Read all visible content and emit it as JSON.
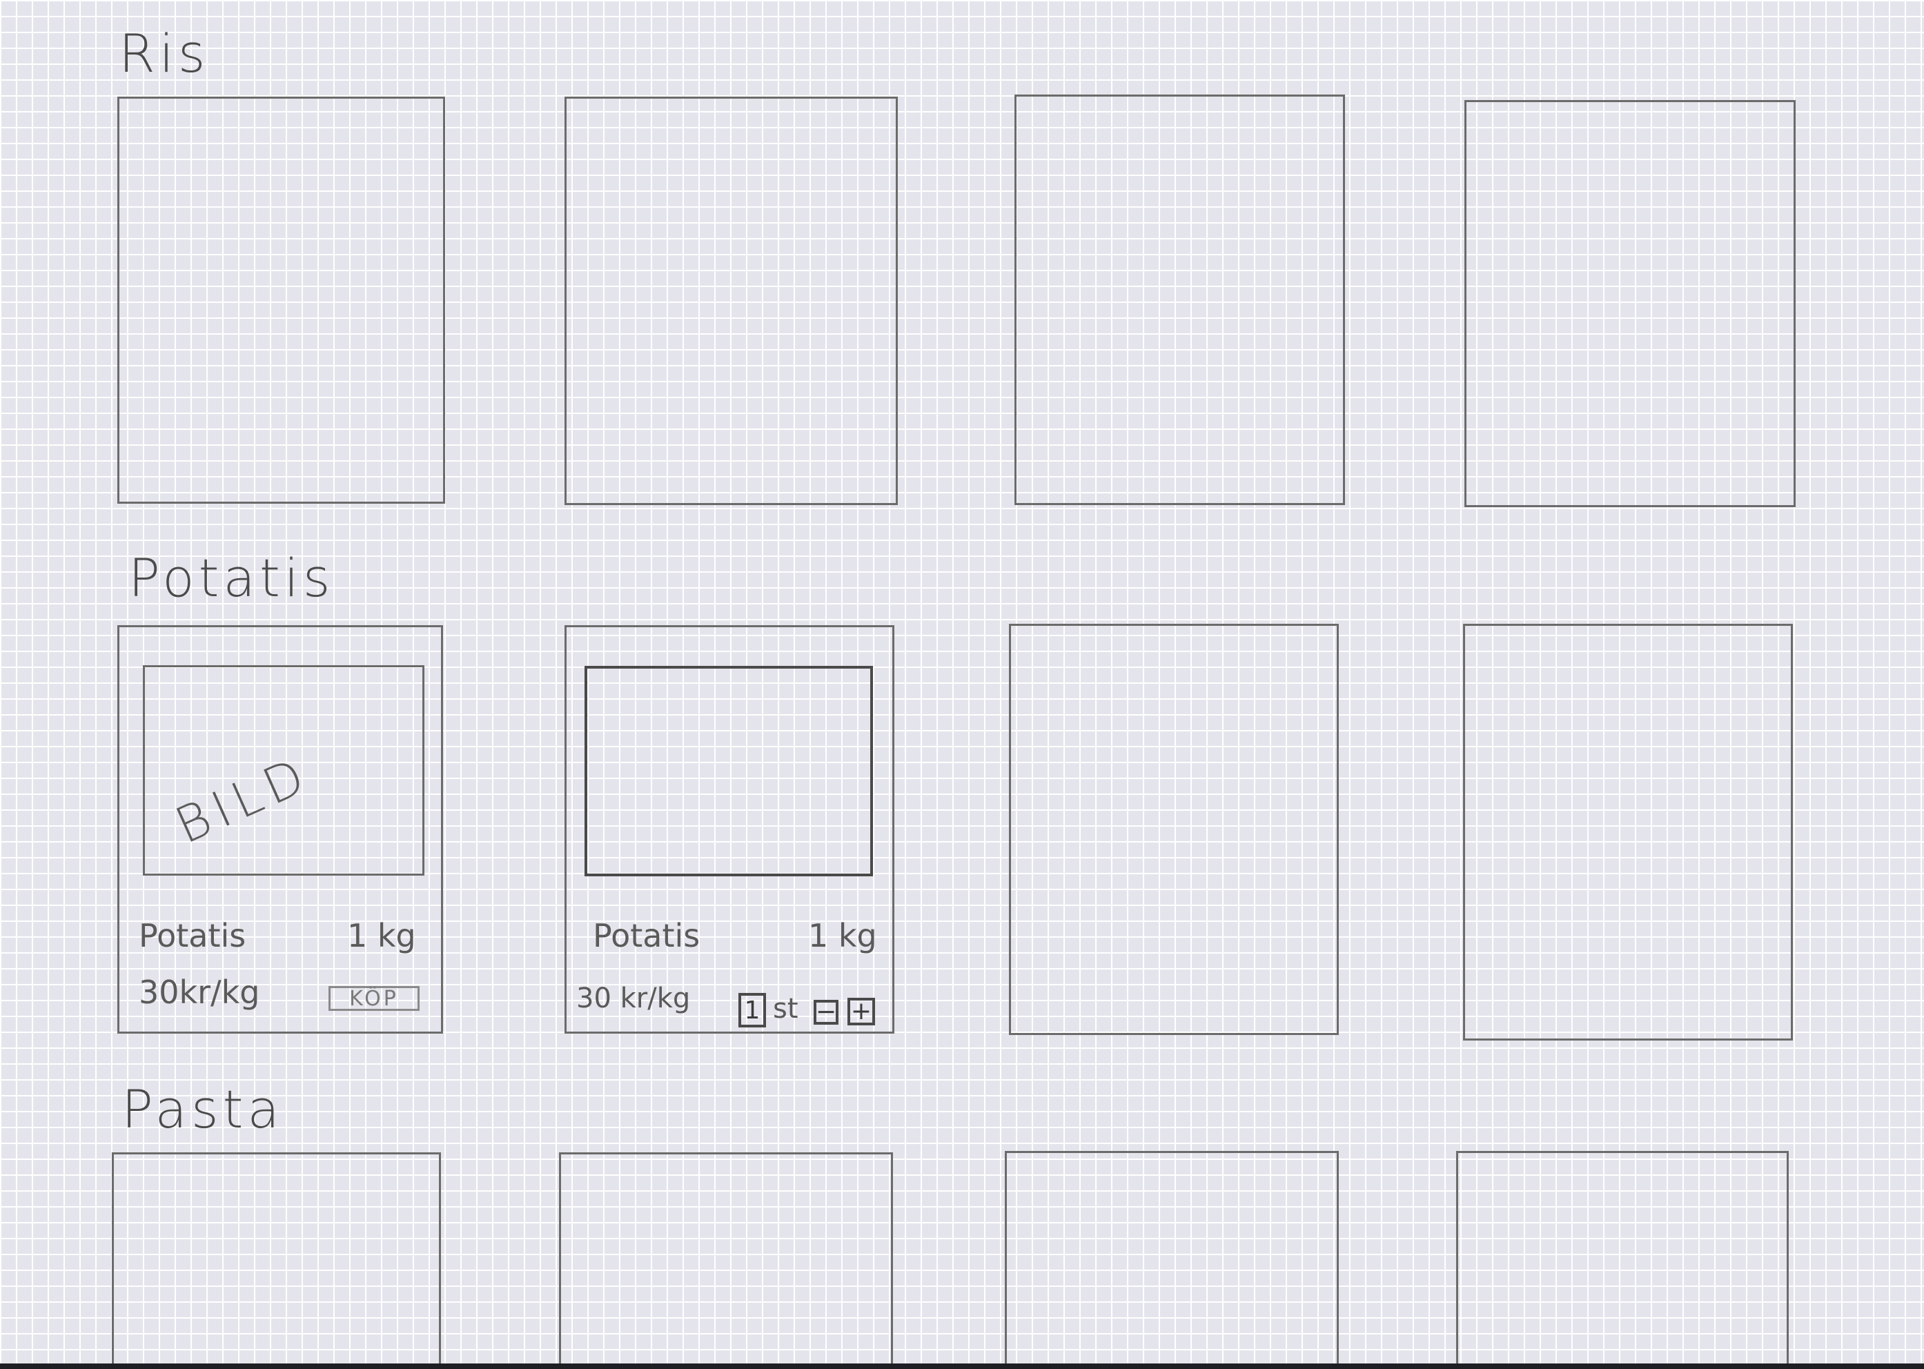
{
  "sections": [
    {
      "heading": "Ris"
    },
    {
      "heading": "Potatis"
    },
    {
      "heading": "Pasta"
    }
  ],
  "products": [
    {
      "image_label": "BILD",
      "name": "Potatis",
      "size": "1 kg",
      "price": "30kr/kg",
      "buy_label": "KÖP"
    },
    {
      "name": "Potatis",
      "size": "1 kg",
      "price": "30 kr/kg",
      "quantity": "1",
      "unit": "st",
      "decrement_label": "−",
      "increment_label": "+"
    }
  ]
}
